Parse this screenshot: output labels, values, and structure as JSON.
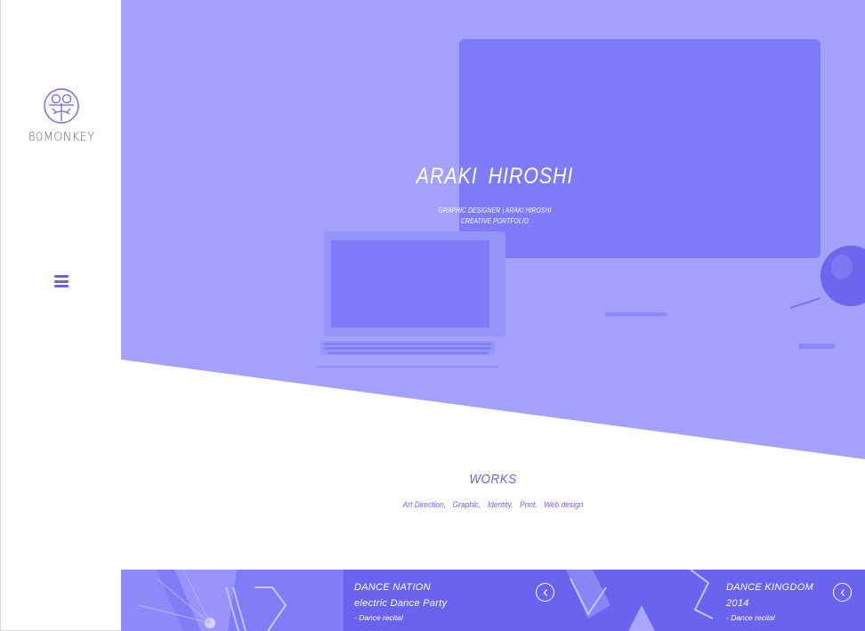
{
  "sidebar": {
    "brand": "80MONKEY",
    "logo_icon": "monkey-logo-icon",
    "menu_icon": "hamburger-menu-icon"
  },
  "hero": {
    "title": "ARAKI  HIROSHI",
    "subtitle_line1": "GRAPHIC DESIGNER  |  ARAKI HIROSHI",
    "subtitle_line2": "CREATIVE PORTFOLIO"
  },
  "works": {
    "title": "WORKS",
    "tags": [
      "Art Direction,",
      "Graphic,",
      "Identity,",
      "Print,",
      "Web design"
    ]
  },
  "cards": [
    {
      "line1": "DANCE NATION",
      "line2": "electric Dance Party",
      "meta": "-  Dance recital",
      "arrow_icon": "chevron-left-icon"
    },
    {
      "line1": "DANCE KINGDOM",
      "line2": "2014",
      "meta": "-  Dance recital",
      "arrow_icon": "chevron-left-icon"
    }
  ],
  "colors": {
    "accent": "#6b63ef",
    "hero_overlay": "#a3a1fc",
    "screen": "#7f7bf8",
    "white": "#ffffff"
  }
}
